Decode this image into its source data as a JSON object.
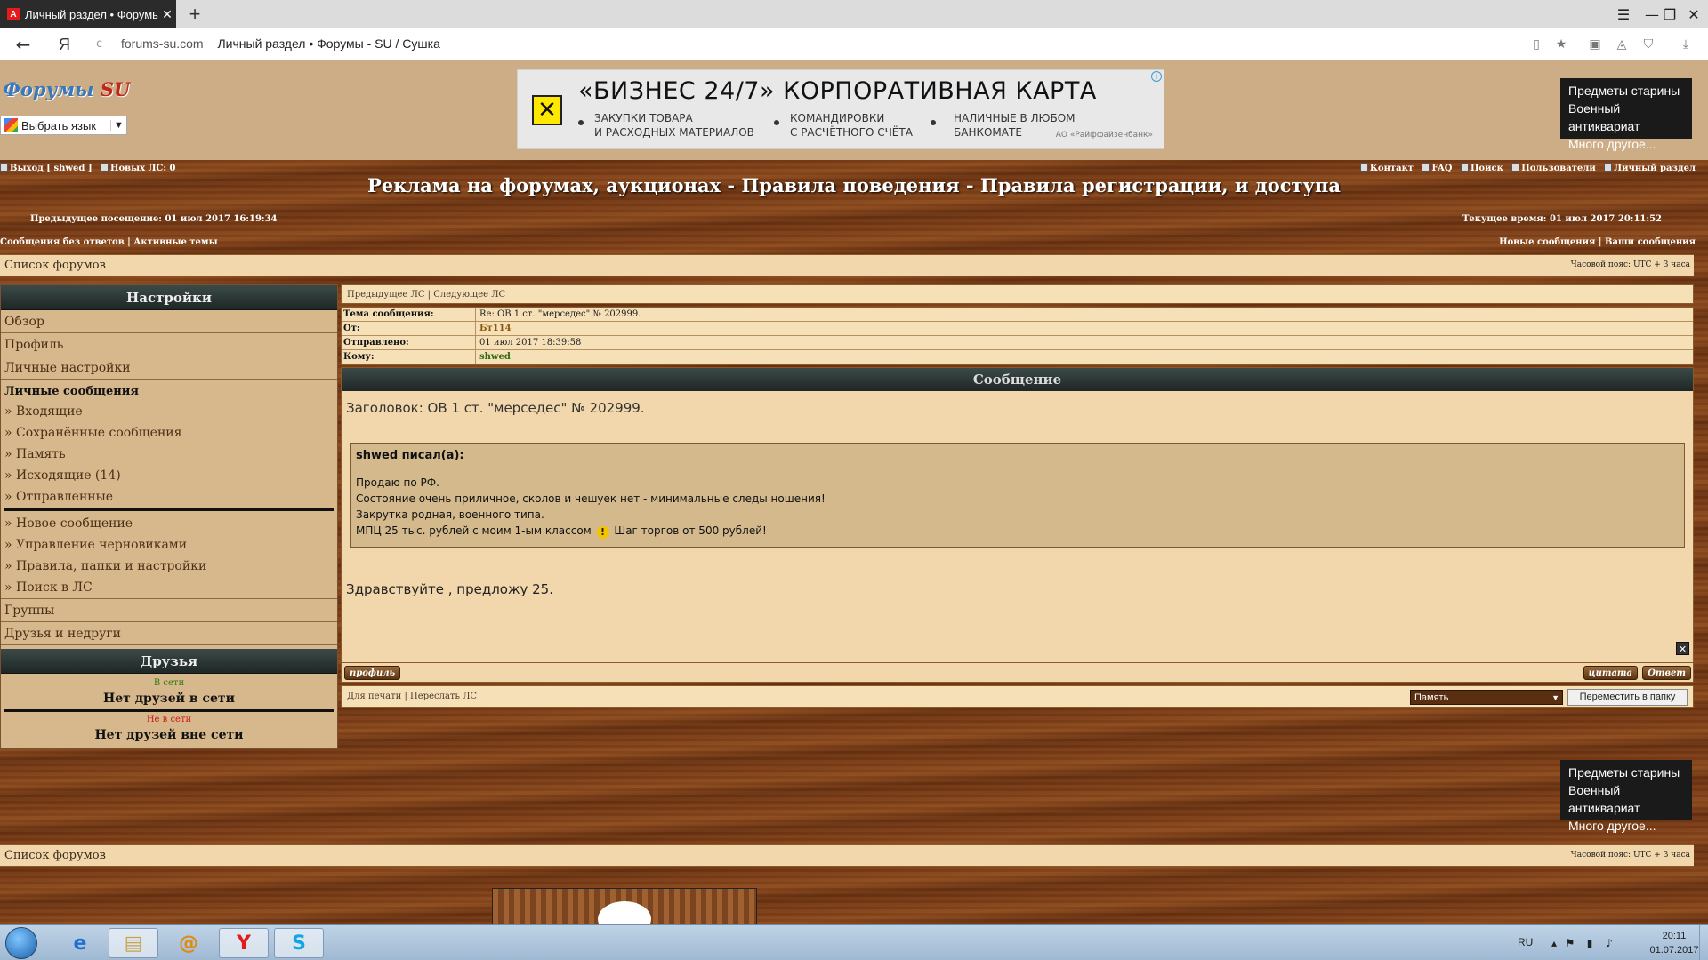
{
  "browser": {
    "tab_title": "Личный раздел • Форумы",
    "tab_favicon": "А",
    "tab_close": "✕",
    "newtab": "+",
    "menu_icon": "☰",
    "minimize": "—",
    "maximize": "❐",
    "close": "✕",
    "back": "←",
    "ya": "Я",
    "reload": "c",
    "url_domain": "forums-su.com",
    "page_title": "Личный раздел • Форумы - SU / Сушка",
    "icons": [
      "bookmark-icon",
      "star-icon",
      "extension-icon",
      "adguard-icon",
      "shield-icon",
      "download-icon"
    ]
  },
  "header": {
    "logo_main": "Форумы",
    "logo_su": "SU",
    "translate_label": "Выбрать язык",
    "translate_arrow": "▼"
  },
  "ad": {
    "logo_glyph": "✕",
    "title": "«БИЗНЕС 24/7» КОРПОРАТИВНАЯ КАРТА",
    "col1": "ЗАКУПКИ ТОВАРА\nИ РАСХОДНЫХ МАТЕРИАЛОВ",
    "col2": "КОМАНДИРОВКИ\nС РАСЧЁТНОГО СЧЁТА",
    "col3": "НАЛИЧНЫЕ В ЛЮБОМ\nБАНКОМАТЕ",
    "note": "АО «Райффайзенбанк»",
    "info": "i"
  },
  "promo": {
    "text": "Предметы старины\nВоенный антиквариат\nМного другое..."
  },
  "forum_nav": {
    "logout": "Выход [ shwed ]",
    "new_pm": "Новых ЛС: 0",
    "right_links": [
      "Контакт",
      "FAQ",
      "Поиск",
      "Пользователи",
      "Личный раздел"
    ],
    "site_title": "Реклама на форумах, аукционах - Правила поведения - Правила регистрации, и доступа",
    "prev_visit": "Предыдущее посещение: 01 июл 2017 16:19:34",
    "current_time": "Текущее время: 01 июл 2017 20:11:52",
    "quick_left": "Сообщения без ответов | Активные темы",
    "quick_right": "Новые сообщения | Ваши сообщения",
    "breadcrumb": "Список форумов",
    "timezone": "Часовой пояс: UTC + 3 часа"
  },
  "settings_panel": {
    "title": "Настройки",
    "items": [
      "Обзор",
      "Профиль",
      "Личные настройки"
    ],
    "pm_title": "Личные сообщения",
    "pm_items": [
      "» Входящие",
      "» Сохранённые сообщения",
      "» Память",
      "» Исходящие (14)",
      "» Отправленные"
    ],
    "pm_items2": [
      "» Новое сообщение",
      "» Управление черновиками",
      "» Правила, папки и настройки",
      "» Поиск в ЛС"
    ],
    "groups": "Группы",
    "friends_foes": "Друзья и недруги"
  },
  "friends": {
    "title": "Друзья",
    "online_label": "В сети",
    "online_none": "Нет друзей в сети",
    "offline_label": "Не в сети",
    "offline_none": "Нет друзей вне сети"
  },
  "message": {
    "nav": "Предыдущее ЛС | Следующее ЛС",
    "subject_label": "Тема сообщения:",
    "subject": "Re: ОВ 1 ст. \"мерседес\" № 202999.",
    "from_label": "От:",
    "from": "Бт114",
    "sent_label": "Отправлено:",
    "sent": "01 июл 2017 18:39:58",
    "to_label": "Кому:",
    "to": "shwed",
    "section_title": "Сообщение",
    "heading": "Заголовок: ОВ 1 ст. \"мерседес\" № 202999.",
    "quote_author": "shwed писал(а):",
    "quote_lines": [
      "Продаю по РФ.",
      "Состояние очень приличное, сколов и чешуек нет - минимальные следы ношения!",
      "Закрутка родная, военного типа."
    ],
    "quote_last_before": "МПЦ 25 тыс. рублей с моим 1-ым классом",
    "quote_last_icon": "!",
    "quote_last_after": "Шаг торгов от 500 рублей!",
    "reply_text": "Здравствуйте , предложу 25.",
    "report_icon": "✕",
    "btn_profile": "профиль",
    "btn_quote": "цитата",
    "btn_reply": "Ответ",
    "bottom_links": "Для печати | Переслать ЛС",
    "folder_selected": "Память",
    "folder_arrow": "▼",
    "move_button": "Переместить в папку"
  },
  "taskbar": {
    "apps": [
      "ie-icon",
      "explorer-icon",
      "mail-agent-icon",
      "yandex-browser-icon",
      "skype-icon"
    ],
    "app_glyphs": [
      "e",
      "▤",
      "@",
      "Y",
      "S"
    ],
    "lang": "RU",
    "time": "20:11",
    "date": "01.07.2017"
  }
}
